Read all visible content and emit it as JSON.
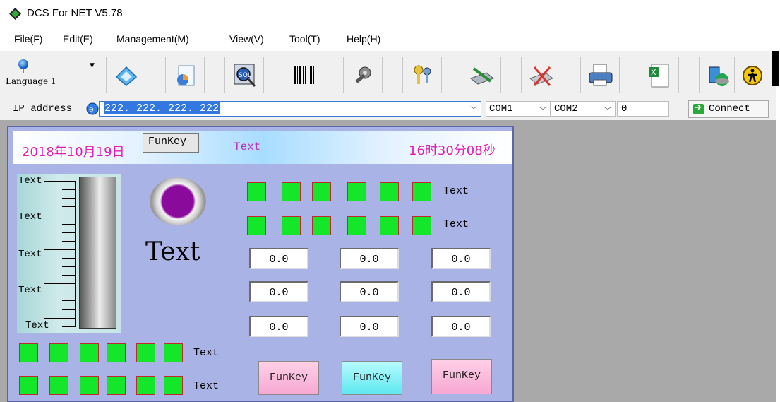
{
  "window": {
    "title": "DCS For NET V5.78"
  },
  "menu": [
    "File(F)",
    "Edit(E)",
    "Management(M)",
    "View(V)",
    "Tool(T)",
    "Help(H)"
  ],
  "toolbar": {
    "language_label": "Language 1",
    "buttons": [
      "home-icon",
      "chart-icon",
      "sql-icon",
      "barcode-icon",
      "tools-icon",
      "keys-icon",
      "edit-icon",
      "delete-icon",
      "print-icon",
      "excel-icon",
      "network-icon",
      "exit-icon"
    ]
  },
  "address_bar": {
    "ip_label": "IP address",
    "ip_value": "222. 222. 222. 222",
    "com1": "COM1",
    "com2": "COM2",
    "port_value": "0",
    "connect_label": "Connect"
  },
  "panel": {
    "date": "2018年10月19日",
    "funkey_top": "FunKey",
    "header_text": "Text",
    "time": "16时30分08秒",
    "gauge_labels": [
      "Text",
      "Text",
      "Text",
      "Text",
      "Text"
    ],
    "big_text": "Text",
    "square_row_labels": [
      "Text",
      "Text"
    ],
    "bottom_square_labels": [
      "Text",
      "Text"
    ],
    "values": [
      [
        "0.0",
        "0.0",
        "0.0"
      ],
      [
        "0.0",
        "0.0",
        "0.0"
      ],
      [
        "0.0",
        "0.0",
        "0.0"
      ]
    ],
    "funkeys": [
      "FunKey",
      "FunKey",
      "FunKey"
    ]
  },
  "colors": {
    "panel_bg": "#aab3e6",
    "led_on": "#14e62a",
    "date_magenta": "#e21cb4",
    "indicator_purple": "#8a0a9c",
    "workarea": "#a9a9a9"
  }
}
